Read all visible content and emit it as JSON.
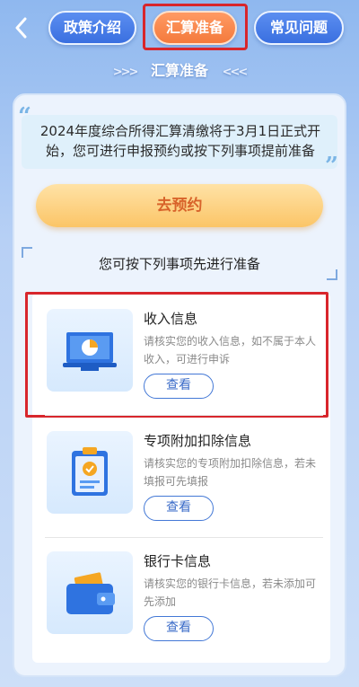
{
  "nav": {
    "back_icon": "chevron-left-icon",
    "tabs": [
      {
        "label": "政策介绍"
      },
      {
        "label": "汇算准备"
      },
      {
        "label": "常见问题"
      }
    ],
    "active_tab": "汇算准备"
  },
  "section": {
    "title": "汇算准备",
    "left_arrows": ">>>",
    "right_arrows": "<<<"
  },
  "notice": {
    "text": "2024年度综合所得汇算清缴将于3月1日正式开始，您可进行申报预约或按下列事项提前准备"
  },
  "reserve_button": {
    "label": "去预约"
  },
  "prep_subtitle": "您可按下列事项先进行准备",
  "items": [
    {
      "title": "收入信息",
      "desc": "请核实您的收入信息，如不属于本人收入，可进行申诉",
      "button": "查看",
      "icon": "presentation-chart-icon"
    },
    {
      "title": "专项附加扣除信息",
      "desc": "请核实您的专项附加扣除信息，若未填报可先填报",
      "button": "查看",
      "icon": "clipboard-check-icon"
    },
    {
      "title": "银行卡信息",
      "desc": "请核实您的银行卡信息，若未添加可先添加",
      "button": "查看",
      "icon": "wallet-card-icon"
    }
  ],
  "colors": {
    "highlight": "#d8262c",
    "accent": "#3a6fe0",
    "reserve_text": "#d8632a"
  }
}
